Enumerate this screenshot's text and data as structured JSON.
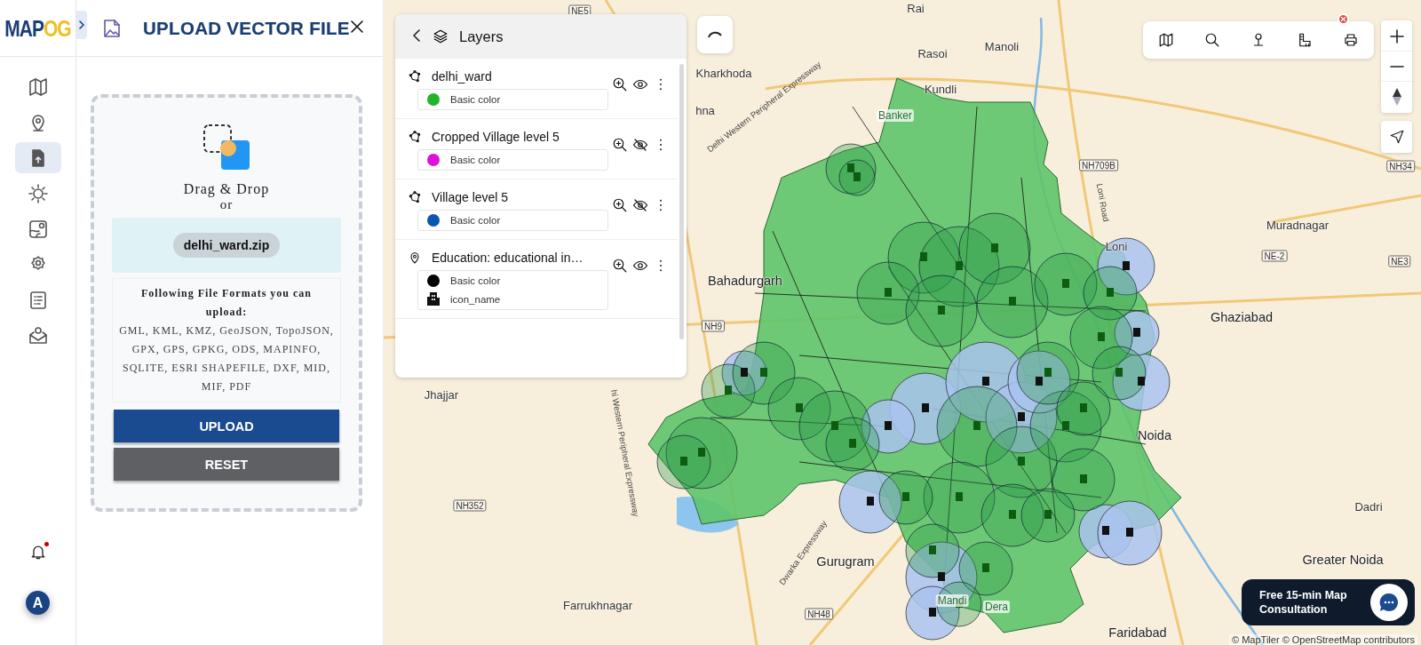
{
  "logo": "MAPOG",
  "rail": {
    "items": [
      {
        "selected": false
      },
      {
        "selected": false
      },
      {
        "selected": true
      },
      {
        "selected": false
      },
      {
        "selected": false
      },
      {
        "selected": false
      },
      {
        "selected": false
      },
      {
        "selected": false
      }
    ],
    "unread_notifications": true,
    "avatar": "A"
  },
  "panel": {
    "title": "UPLOAD VECTOR FILE",
    "drop_text": "Drag & Drop",
    "or_text": "or",
    "file_name": "delhi_ward.zip",
    "formats_heading": "Following File Formats you can upload:",
    "formats": "GML, KML, KMZ, GeoJSON, TopoJSON, GPX, GPS, GPKG, ODS, MAPINFO, SQLITE, ESRI SHAPEFILE, DXF, MID, MIF, PDF",
    "buttons": [
      "UPLOAD",
      "RESET"
    ]
  },
  "layers": {
    "title": "Layers",
    "items": [
      {
        "name": "delhi_ward",
        "kind": "polygon",
        "visible": true,
        "styles": [
          {
            "kind": "color",
            "label": "Basic color",
            "color": "#1fb52a"
          }
        ]
      },
      {
        "name": "Cropped Village level 5",
        "kind": "polygon",
        "visible": false,
        "styles": [
          {
            "kind": "color",
            "label": "Basic color",
            "color": "#e010d8"
          }
        ]
      },
      {
        "name": "Village level 5",
        "kind": "polygon",
        "visible": false,
        "styles": [
          {
            "kind": "color",
            "label": "Basic color",
            "color": "#0b56b0"
          }
        ]
      },
      {
        "name": "Education: educational in…",
        "kind": "point",
        "visible": true,
        "styles": [
          {
            "kind": "color",
            "label": "Basic color",
            "color": "#000000"
          },
          {
            "kind": "icon",
            "label": "icon_name"
          }
        ]
      }
    ]
  },
  "map": {
    "labels": [
      {
        "text": "NE5",
        "kind": "shield"
      },
      {
        "text": "Rai",
        "kind": "place"
      },
      {
        "text": "Manoli",
        "kind": "place"
      },
      {
        "text": "Rasoi",
        "kind": "place"
      },
      {
        "text": "Kharkhoda",
        "kind": "place"
      },
      {
        "text": "hna",
        "kind": "place"
      },
      {
        "text": "Kundli",
        "kind": "place"
      },
      {
        "text": "Banker",
        "kind": "faint"
      },
      {
        "text": "Delhi Western Peripheral Expressway",
        "kind": "road"
      },
      {
        "text": "NH709B",
        "kind": "shield"
      },
      {
        "text": "Loni Road",
        "kind": "road"
      },
      {
        "text": "NH34",
        "kind": "shield"
      },
      {
        "text": "Muradnagar",
        "kind": "place"
      },
      {
        "text": "NE-2",
        "kind": "shield"
      },
      {
        "text": "NE3",
        "kind": "shield"
      },
      {
        "text": "Loni",
        "kind": "place"
      },
      {
        "text": "Bahadurgarh",
        "kind": "city"
      },
      {
        "text": "Ghaziabad",
        "kind": "city"
      },
      {
        "text": "NH9",
        "kind": "shield"
      },
      {
        "text": "Jhajjar",
        "kind": "place"
      },
      {
        "text": "hi Western Peripheral Expressway",
        "kind": "road"
      },
      {
        "text": "Noida",
        "kind": "city"
      },
      {
        "text": "Dadri",
        "kind": "place"
      },
      {
        "text": "NH352",
        "kind": "shield"
      },
      {
        "text": "Dwarka Expressway",
        "kind": "road"
      },
      {
        "text": "Gurugram",
        "kind": "city"
      },
      {
        "text": "Greater Noida",
        "kind": "city"
      },
      {
        "text": "Farrukhnagar",
        "kind": "place"
      },
      {
        "text": "NH48",
        "kind": "shield"
      },
      {
        "text": "Mandi",
        "kind": "faint"
      },
      {
        "text": "Dera",
        "kind": "faint"
      },
      {
        "text": "Faridabad",
        "kind": "city"
      }
    ],
    "attribution": "© MapTiler © OpenStreetMap contributors"
  },
  "consultation": "Free 15-min Map Consultation"
}
